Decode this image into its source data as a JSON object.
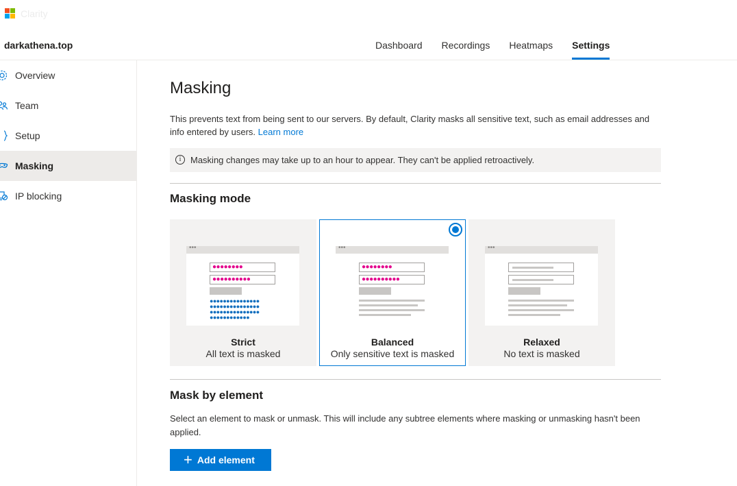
{
  "app": {
    "brand_faded": "Clarity"
  },
  "header": {
    "project_name": "darkathena.top",
    "tabs": [
      {
        "label": "Dashboard"
      },
      {
        "label": "Recordings"
      },
      {
        "label": "Heatmaps"
      },
      {
        "label": "Settings",
        "active": true
      }
    ]
  },
  "sidebar": {
    "items": [
      {
        "label": "Overview",
        "icon": "gear-icon"
      },
      {
        "label": "Team",
        "icon": "team-icon"
      },
      {
        "label": "Setup",
        "icon": "braces-icon"
      },
      {
        "label": "Masking",
        "icon": "mask-icon",
        "active": true
      },
      {
        "label": "IP blocking",
        "icon": "ip-block-icon"
      }
    ]
  },
  "main": {
    "title": "Masking",
    "description": "This prevents text from being sent to our servers. By default, Clarity masks all sensitive text, such as email addresses and info entered by users.",
    "learn_more": "Learn more",
    "notice": "Masking changes may take up to an hour to appear. They can't be applied retroactively.",
    "masking_mode": {
      "heading": "Masking mode",
      "options": [
        {
          "label": "Strict",
          "sub": "All text is masked",
          "selected": false
        },
        {
          "label": "Balanced",
          "sub": "Only sensitive text is masked",
          "selected": true
        },
        {
          "label": "Relaxed",
          "sub": "No text is masked",
          "selected": false
        }
      ]
    },
    "mask_by_element": {
      "heading": "Mask by element",
      "description": "Select an element to mask or unmask. This will include any subtree elements where masking or unmasking hasn't been applied.",
      "add_button": "Add element"
    }
  },
  "colors": {
    "accent": "#0078d4",
    "mask_pink": "#e3008c",
    "mask_blue": "#106ebe"
  }
}
